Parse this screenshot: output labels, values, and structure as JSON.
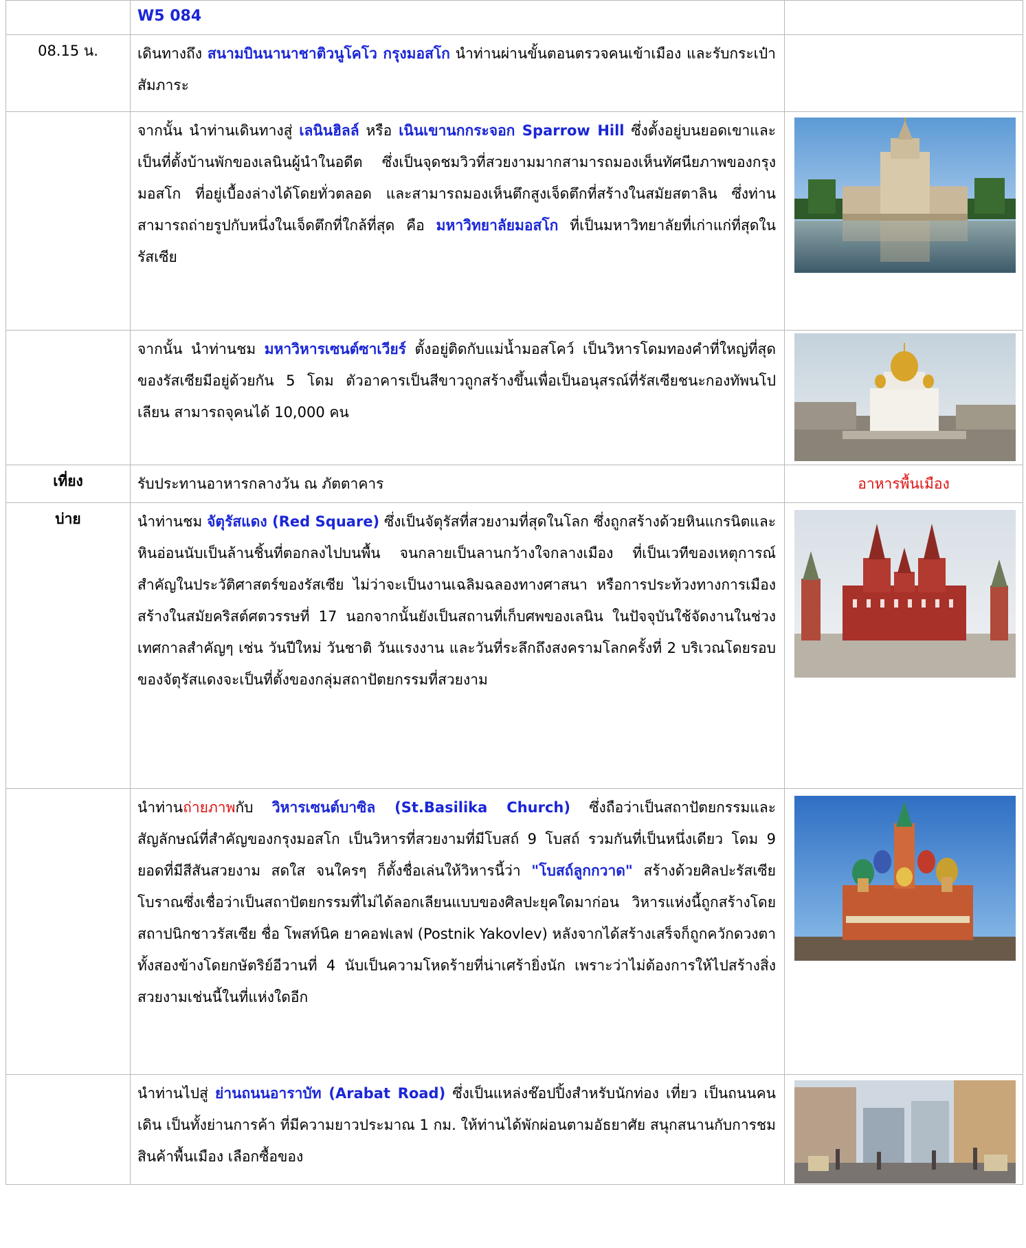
{
  "rows": [
    {
      "time": "",
      "flight": "W5 084"
    },
    {
      "time": "08.15 น.",
      "p1": "เดินทางถึง ",
      "h1": "สนามบินนานาชาติวนูโคโว กรุงมอสโก",
      "p2": " นำท่านผ่านขั้นตอนตรวจคนเข้าเมือง และรับกระเป๋าสัมภาระ"
    },
    {
      "time": "",
      "p1": "จากนั้น นำท่านเดินทางสู่ ",
      "h1": "เลนินฮิลล์",
      "p2": " หรือ ",
      "h2": "เนินเขานกกระจอก Sparrow Hill",
      "p3": " ซึ่งตั้งอยู่บนยอดเขาและเป็นที่ตั้งบ้านพักของเลนินผู้นำในอดีต ซึ่งเป็นจุดชมวิวที่สวยงามมากสามารถมองเห็นทัศนียภาพของกรุงมอสโก ที่อยู่เบื้องล่างได้โดยทั่วตลอด และสามารถมองเห็นตึกสูงเจ็ดตึกที่สร้างในสมัยสตาลิน ซึ่งท่านสามารถถ่ายรูปกับหนึ่งในเจ็ดตึกที่ใกล้ที่สุด คือ ",
      "h3": "มหาวิทยาลัยมอสโก",
      "p4": " ที่เป็นมหาวิทยาลัยที่เก่าแก่ที่สุดในรัสเซีย",
      "image": "moscow-state-university"
    },
    {
      "time": "",
      "p1": "จากนั้น นำท่านชม ",
      "h1": "มหาวิหารเซนต์ซาเวียร์",
      "p2": " ตั้งอยู่ติดกับแม่น้ำมอสโคว์ เป็นวิหารโดมทองคำที่ใหญ่ที่สุดของรัสเซียมีอยู่ด้วยกัน 5 โดม ตัวอาคารเป็นสีขาวถูกสร้างขึ้นเพื่อเป็นอนุสรณ์ที่รัสเซียชนะกองทัพนโปเลียน สามารถจุคนได้ 10,000 คน",
      "image": "cathedral-christ-saviour"
    },
    {
      "time": "เที่ยง",
      "text": "รับประทานอาหารกลางวัน ณ ภัตตาคาร",
      "meal": "อาหารพื้นเมือง"
    },
    {
      "time": "บ่าย",
      "p1": "นำท่านชม ",
      "h1": "จัตุรัสแดง (Red Square)",
      "p2": " ซึ่งเป็นจัตุรัสที่สวยงามที่สุดในโลก ซึ่งถูกสร้างด้วยหินแกรนิตและหินอ่อนนับเป็นล้านชิ้นที่ตอกลงไปบนพื้น จนกลายเป็นลานกว้างใจกลางเมือง ที่เป็นเวทีของเหตุการณ์สำคัญในประวัติศาสตร์ของรัสเซีย ไม่ว่าจะเป็นงานเฉลิมฉลองทางศาสนา หรือการประท้วงทางการเมือง สร้างในสมัยคริสต์ศตวรรษที่ 17 นอกจากนั้นยังเป็นสถานที่เก็บศพของเลนิน ในปัจจุบันใช้จัดงานในช่วงเทศกาลสำคัญๆ เช่น วันปีใหม่ วันชาติ วันแรงงาน และวันที่ระลึกถึงสงครามโลกครั้งที่ 2 บริเวณโดยรอบของจัตุรัสแดงจะเป็นที่ตั้งของกลุ่มสถาปัตยกรรมที่สวยงาม",
      "image": "red-square-museum"
    },
    {
      "time": "",
      "p1": "นำท่าน",
      "r1": "ถ่ายภาพ",
      "p2": "กับ ",
      "h1": "วิหารเซนต์บาซิล (St.Basilika Church)",
      "p3": " ซึ่งถือว่าเป็นสถาปัตยกรรมและสัญลักษณ์ที่สำคัญของกรุงมอสโก เป็นวิหารที่สวยงามที่มีโบสถ์ 9 โบสถ์ รวมกันที่เป็นหนึ่งเดียว โดม 9 ยอดที่มีสีสันสวยงาม สดใส จนใครๆ ก็ตั้งชื่อเล่นให้วิหารนี้ว่า ",
      "h2": "\"โบสถ์ลูกกวาด\"",
      "p4": " สร้างด้วยศิลปะรัสเซียโบราณซึ่งเชื่อว่าเป็นสถาปัตยกรรมที่ไม่ได้ลอกเลียนแบบของศิลปะยุคใดมาก่อน วิหารแห่งนี้ถูกสร้างโดยสถาปนิกชาวรัสเซีย ชื่อ โพสท์นิค ยาคอฟเลฟ (Postnik Yakovlev) หลังจากได้สร้างเสร็จก็ถูกควักดวงตาทั้งสองข้างโดยกษัตริย์อีวานที่ 4 นับเป็นความโหดร้ายที่น่าเศร้ายิ่งนัก เพราะว่าไม่ต้องการให้ไปสร้างสิ่งสวยงามเช่นนี้ในที่แห่งใดอีก",
      "image": "st-basil-cathedral"
    },
    {
      "time": "",
      "p1": "นำท่านไปสู่ ",
      "h1": "ย่านถนนอาราบัท (Arabat Road)",
      "p2": " ซึ่งเป็นแหล่งช๊อปปิ้งสำหรับนักท่อง เที่ยว เป็นถนนคนเดิน เป็นทั้งย่านการค้า ที่มีความยาวประมาณ 1 กม. ให้ท่านได้พักผ่อนตามอัธยาศัย สนุกสนานกับการชมสินค้าพื้นเมือง เลือกซื้อของ",
      "image": "arbat-street"
    }
  ]
}
